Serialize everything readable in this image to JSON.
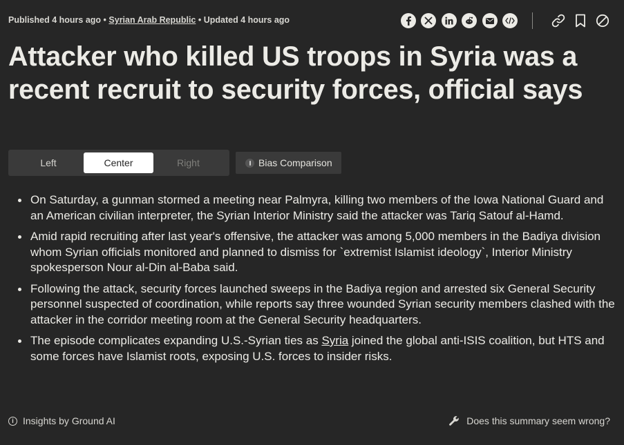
{
  "meta": {
    "published": "Published 4 hours ago",
    "sep1": "•",
    "location": "Syrian Arab Republic",
    "sep2": "•",
    "updated": "Updated 4 hours ago"
  },
  "share_icons": [
    "facebook-icon",
    "x-icon",
    "linkedin-icon",
    "reddit-icon",
    "email-icon",
    "embed-icon"
  ],
  "tool_icons": [
    "link-icon",
    "bookmark-icon",
    "block-icon"
  ],
  "headline": "Attacker who killed US troops in Syria was a recent recruit to security forces, official says",
  "bias_tabs": {
    "left": "Left",
    "center": "Center",
    "right": "Right",
    "selected": "Center"
  },
  "bias_comparison_label": "Bias Comparison",
  "summary": {
    "b1": "On Saturday, a gunman stormed a meeting near Palmyra, killing two members of the Iowa National Guard and an American civilian interpreter, the Syrian Interior Ministry said the attacker was Tariq Satouf al-Hamd.",
    "b2": "Amid rapid recruiting after last year's offensive, the attacker was among 5,000 members in the Badiya division whom Syrian officials monitored and planned to dismiss for `extremist Islamist ideology`, Interior Ministry spokesperson Nour al-Din al-Baba said.",
    "b3": "Following the attack, security forces launched sweeps in the Badiya region and arrested six General Security personnel suspected of coordination, while reports say three wounded Syrian security members clashed with the attacker in the corridor meeting room at the General Security headquarters.",
    "b4_before": "The episode complicates expanding U.S.-Syrian ties as ",
    "b4_link": "Syria",
    "b4_after": " joined the global anti-ISIS coalition, but HTS and some forces have Islamist roots, exposing U.S. forces to insider risks."
  },
  "footer": {
    "insights": "Insights by Ground AI",
    "feedback": "Does this summary seem wrong?"
  },
  "colors": {
    "background": "#262626",
    "text": "#ecebe6",
    "panel": "#3a3a3a",
    "selected_tab": "#ffffff"
  }
}
